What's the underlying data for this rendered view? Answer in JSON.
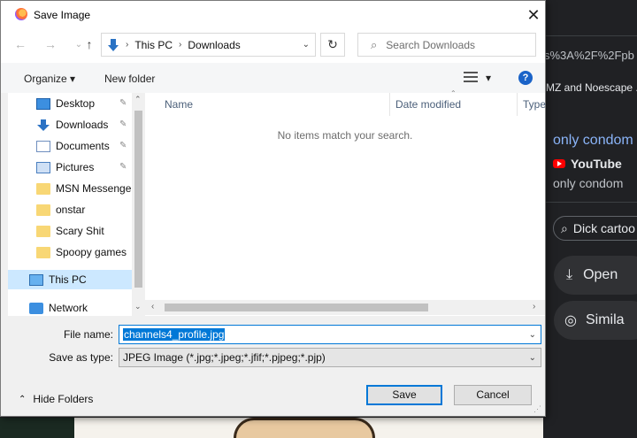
{
  "dialog": {
    "title": "Save Image",
    "close": "✕",
    "nav": {
      "back": "←",
      "forward": "→",
      "up": "↑",
      "breadcrumb": [
        "This PC",
        "Downloads"
      ],
      "refresh": "↻",
      "search_placeholder": "Search Downloads"
    },
    "toolbar": {
      "organize": "Organize ▾",
      "new_folder": "New folder",
      "view_dd": "▾",
      "help": "?"
    },
    "sidebar": {
      "items": [
        {
          "label": "Desktop",
          "pinned": true,
          "icon": "desktop-icon"
        },
        {
          "label": "Downloads",
          "pinned": true,
          "icon": "download-icon"
        },
        {
          "label": "Documents",
          "pinned": true,
          "icon": "document-icon"
        },
        {
          "label": "Pictures",
          "pinned": true,
          "icon": "picture-icon"
        },
        {
          "label": "MSN Messenger",
          "pinned": false,
          "icon": "folder-icon"
        },
        {
          "label": "onstar",
          "pinned": false,
          "icon": "folder-icon"
        },
        {
          "label": "Scary Shit",
          "pinned": false,
          "icon": "folder-icon"
        },
        {
          "label": "Spoopy games",
          "pinned": false,
          "icon": "folder-icon"
        },
        {
          "label": "This PC",
          "pinned": false,
          "icon": "computer-icon",
          "selected": true
        },
        {
          "label": "Network",
          "pinned": false,
          "icon": "network-icon"
        }
      ],
      "pin_glyph": "📌"
    },
    "columns": [
      "Name",
      "Date modified",
      "Type"
    ],
    "empty_message": "No items match your search.",
    "file_name_label": "File name:",
    "file_name_value": "channels4_profile.jpg",
    "save_type_label": "Save as type:",
    "save_type_value": "JPEG Image (*.jpg;*.jpeg;*.jfif;*.pjpeg;*.pjp)",
    "hide_folders": "Hide Folders",
    "save_button": "Save",
    "cancel_button": "Cancel"
  },
  "background": {
    "url_fragment": "s%3A%2F%2Fpb",
    "tab_text": "MZ and Noescape ...",
    "result_title": "only condom",
    "source": "YouTube",
    "subtitle": "only condom",
    "search_chip": "Dick cartoo",
    "open_button": "Open",
    "similar_button": "Simila"
  },
  "colors": {
    "accent": "#0078d7",
    "selection": "#cce8ff",
    "bg_dark": "#202124",
    "link_blue": "#8ab4f8"
  }
}
